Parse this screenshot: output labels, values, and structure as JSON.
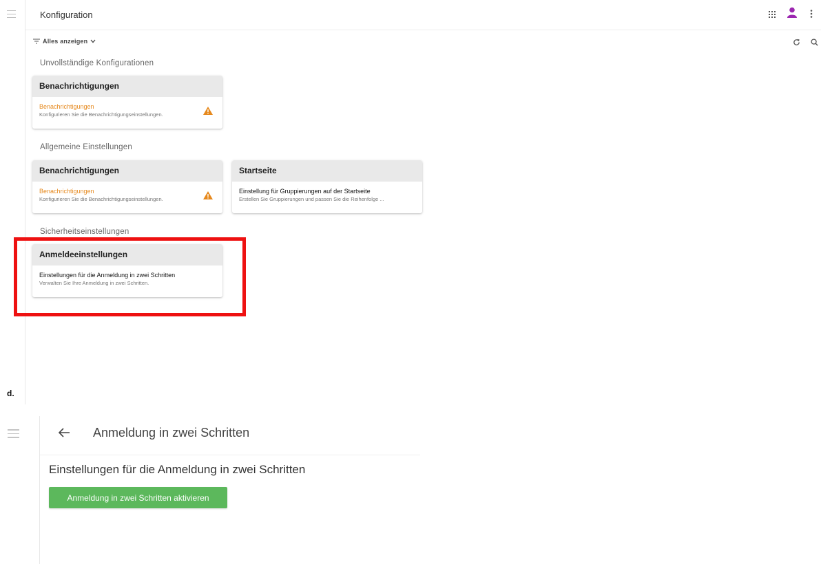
{
  "header": {
    "title": "Konfiguration",
    "icons": [
      "apps-grid-icon",
      "user-avatar-icon",
      "more-vert-icon"
    ]
  },
  "filter": {
    "label": "Alles anzeigen"
  },
  "toolbar_icons": [
    "refresh-icon",
    "search-icon"
  ],
  "sections": [
    {
      "title": "Unvollständige Konfigurationen",
      "cards": [
        {
          "title": "Benachrichtigungen",
          "line1": "Benachrichtigungen",
          "line2": "Konfigurieren Sie die Benachrichtigungseinstellungen.",
          "warning": true
        }
      ]
    },
    {
      "title": "Allgemeine Einstellungen",
      "cards": [
        {
          "title": "Benachrichtigungen",
          "line1": "Benachrichtigungen",
          "line2": "Konfigurieren Sie die Benachrichtigungseinstellungen.",
          "warning": true
        },
        {
          "title": "Startseite",
          "line1": "Einstellung für Gruppierungen auf der Startseite",
          "line2": "Erstellen Sie Gruppierungen und passen Sie die Reihenfolge ...",
          "warning": false
        }
      ]
    },
    {
      "title": "Sicherheitseinstellungen",
      "cards": [
        {
          "title": "Anmeldeeinstellungen",
          "line1": "Einstellungen für die Anmeldung in zwei Schritten",
          "line2": "Verwalten Sie Ihre Anmeldung in zwei Schritten.",
          "warning": false
        }
      ]
    }
  ],
  "step_label": "d.",
  "detail": {
    "title": "Anmeldung in zwei Schritten",
    "heading": "Einstellungen für die Anmeldung in zwei Schritten",
    "button_label": "Anmeldung in zwei Schritten aktivieren"
  },
  "colors": {
    "warning": "#e6891d",
    "highlight": "#ee1111",
    "primary_button": "#5cb85c",
    "avatar": "#9c27b0"
  }
}
